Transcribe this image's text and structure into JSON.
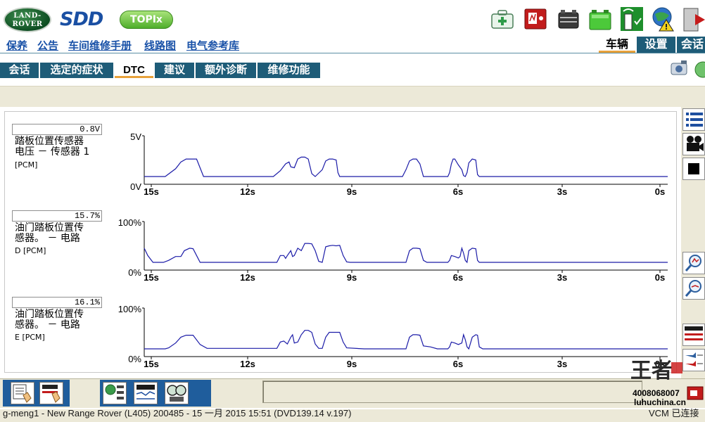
{
  "header": {
    "landrover_line1": "LAND-",
    "landrover_line2": "ROVER",
    "app_name": "SDD",
    "topix_label": "TOPIx"
  },
  "links": [
    "保养",
    "公告",
    "车间维修手册",
    "线路图",
    "电气参考库"
  ],
  "top_tabs": [
    {
      "label": "车辆",
      "active": true
    },
    {
      "label": "设置",
      "active": false
    },
    {
      "label": "会话",
      "active": false
    }
  ],
  "nav_tabs": [
    {
      "label": "会话",
      "active": false
    },
    {
      "label": "选定的症状",
      "active": false
    },
    {
      "label": "DTC",
      "active": true
    },
    {
      "label": "建议",
      "active": false
    },
    {
      "label": "额外诊断",
      "active": false
    },
    {
      "label": "维修功能",
      "active": false
    }
  ],
  "colors": {
    "trace": "#1c1ca8",
    "nav_bg": "#1e5c78",
    "link": "#1a52a8",
    "accent": "#e8a13a"
  },
  "chart_data": [
    {
      "type": "line",
      "value_display": "0.8V",
      "label_line1": "踏板位置传感器",
      "label_line2": "电压 － 传感器 1",
      "label_unit": "[PCM]",
      "ylabels": [
        "5V",
        "0V"
      ],
      "ylim": [
        0,
        5
      ],
      "xlim": [
        15,
        0
      ],
      "xticks": [
        "15s",
        "12s",
        "9s",
        "6s",
        "3s",
        "0s"
      ],
      "x": [
        15,
        14.4,
        14.1,
        13.95,
        13.8,
        13.7,
        13.5,
        13.3,
        13.2,
        11.3,
        11.1,
        10.95,
        10.85,
        10.8,
        10.7,
        10.6,
        10.5,
        10.4,
        10.3,
        10.2,
        10.1,
        9.9,
        9.8,
        9.7,
        9.6,
        9.5,
        9.45,
        9.4,
        9.3,
        9.2,
        9.1,
        8.9,
        8.8,
        8.7,
        7.6,
        7.5,
        7.4,
        7.3,
        7.2,
        7.1,
        7.0,
        6.9,
        6.8,
        6.3,
        6.25,
        6.2,
        6.15,
        6.1,
        6.0,
        5.9,
        5.85,
        5.8,
        5.75,
        5.7,
        5.6,
        5.5,
        5.45,
        5.4,
        5.3,
        5.2,
        0
      ],
      "y": [
        0.8,
        0.8,
        1.6,
        2.3,
        2.6,
        2.6,
        2.6,
        0.8,
        0.8,
        0.8,
        1.4,
        2.1,
        2.3,
        1.8,
        1.7,
        2.6,
        2.8,
        2.8,
        2.6,
        1.1,
        0.8,
        1.5,
        2.4,
        2.6,
        2.6,
        2.5,
        1.2,
        0.8,
        0.8,
        0.8,
        0.8,
        0.8,
        0.8,
        0.8,
        0.8,
        1.5,
        2.4,
        2.6,
        2.6,
        2.1,
        0.8,
        0.8,
        0.8,
        0.8,
        1.2,
        2.1,
        2.6,
        2.6,
        2.0,
        1.5,
        0.9,
        0.8,
        1.2,
        2.2,
        2.6,
        2.5,
        1.0,
        0.8,
        0.8,
        0.8,
        0.8
      ]
    },
    {
      "type": "line",
      "value_display": "15.7%",
      "label_line1": "油门踏板位置传",
      "label_line2": "感器。 － 电路",
      "label_unit": "D [PCM]",
      "ylabels": [
        "100%",
        "0%"
      ],
      "ylim": [
        0,
        100
      ],
      "xlim": [
        15,
        0
      ],
      "xticks": [
        "15s",
        "12s",
        "9s",
        "6s",
        "3s",
        "0s"
      ],
      "x": [
        15,
        14.9,
        14.75,
        14.6,
        14.45,
        14.3,
        14.1,
        13.95,
        13.85,
        13.7,
        13.6,
        13.5,
        13.4,
        13.2,
        11.2,
        11.1,
        11.0,
        10.95,
        10.9,
        10.8,
        10.75,
        10.7,
        10.6,
        10.5,
        10.4,
        10.3,
        10.2,
        10.1,
        10.0,
        9.9,
        9.8,
        9.7,
        9.6,
        9.5,
        9.4,
        9.3,
        9.2,
        9.1,
        8.7,
        7.6,
        7.5,
        7.4,
        7.3,
        7.2,
        7.1,
        7.0,
        6.9,
        6.6,
        6.3,
        6.25,
        6.2,
        6.1,
        6.0,
        5.95,
        5.9,
        5.85,
        5.8,
        5.75,
        5.7,
        5.6,
        5.5,
        5.45,
        5.4,
        5.3,
        5.2,
        0
      ],
      "y": [
        45,
        30,
        16,
        16,
        16,
        20,
        28,
        28,
        40,
        45,
        44,
        30,
        16,
        16,
        16,
        30,
        30,
        24,
        30,
        40,
        28,
        30,
        45,
        40,
        55,
        55,
        54,
        40,
        18,
        16,
        48,
        50,
        51,
        50,
        51,
        30,
        17,
        16,
        16,
        16,
        16,
        40,
        45,
        45,
        44,
        20,
        16,
        16,
        16,
        20,
        30,
        28,
        25,
        28,
        45,
        35,
        20,
        16,
        40,
        45,
        44,
        20,
        16,
        16,
        16,
        16
      ]
    },
    {
      "type": "line",
      "value_display": "16.1%",
      "label_line1": "油门踏板位置传",
      "label_line2": "感器。 － 电路",
      "label_unit": "E [PCM]",
      "ylabels": [
        "100%",
        "0%"
      ],
      "ylim": [
        0,
        100
      ],
      "xlim": [
        15,
        0
      ],
      "xticks": [
        "15s",
        "12s",
        "9s",
        "6s",
        "3s",
        "0s"
      ],
      "x": [
        15,
        14.4,
        14.3,
        14.1,
        13.95,
        13.8,
        13.7,
        13.6,
        13.4,
        13.2,
        11.2,
        11.1,
        11.0,
        10.9,
        10.8,
        10.75,
        10.7,
        10.6,
        10.5,
        10.4,
        10.3,
        10.2,
        10.1,
        10.0,
        9.9,
        9.8,
        9.7,
        9.6,
        9.5,
        9.4,
        9.3,
        9.2,
        8.7,
        7.6,
        7.5,
        7.4,
        7.3,
        7.2,
        7.1,
        7.0,
        6.8,
        6.6,
        6.3,
        6.25,
        6.2,
        6.1,
        6.0,
        5.9,
        5.85,
        5.8,
        5.75,
        5.7,
        5.6,
        5.5,
        5.45,
        5.4,
        5.3,
        0
      ],
      "y": [
        16,
        16,
        18,
        28,
        40,
        44,
        44,
        44,
        25,
        17,
        17,
        30,
        32,
        26,
        40,
        45,
        28,
        30,
        45,
        54,
        54,
        50,
        26,
        17,
        17,
        40,
        50,
        50,
        50,
        50,
        30,
        18,
        16,
        16,
        16,
        40,
        45,
        45,
        44,
        22,
        20,
        16,
        16,
        20,
        30,
        28,
        25,
        28,
        45,
        35,
        20,
        16,
        40,
        45,
        44,
        20,
        16,
        16
      ]
    }
  ],
  "status": {
    "left": "g-meng1 - New Range Rover (L405) 200485 - 15 一月 2015 15:51 (DVD139.14 v.197)",
    "right": "VCM 已连接"
  },
  "watermark": {
    "brand": "王者",
    "phone": "4008068007",
    "site": "luhuchina.cn"
  }
}
